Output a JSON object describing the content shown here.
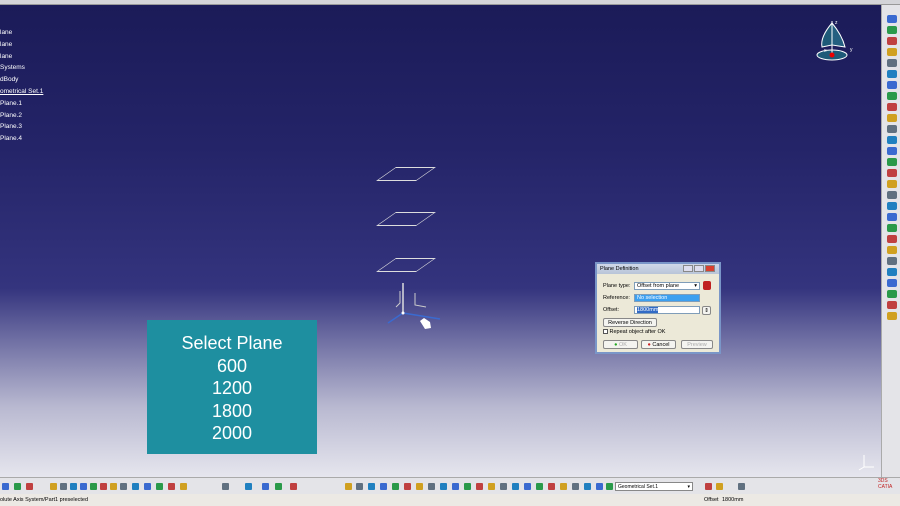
{
  "tree": {
    "items": [
      "lane",
      "lane",
      "lane",
      "Systems",
      "dBody",
      "ometrical Set.1",
      "Plane.1",
      "Plane.2",
      "Plane.3",
      "Plane.4"
    ]
  },
  "overlay": {
    "lines": [
      "Select Plane",
      "600",
      "1200",
      "1800",
      "2000"
    ]
  },
  "dialog": {
    "title": "Plane Definition",
    "plane_type_label": "Plane type:",
    "plane_type_value": "Offset from plane",
    "reference_label": "Reference:",
    "reference_value": "No selection",
    "offset_label": "Offset:",
    "offset_value": "1800mm",
    "reverse_label": "Reverse Direction",
    "repeat_label": "Repeat object after OK",
    "repeat_checked": false,
    "ok_label": "OK",
    "cancel_label": "Cancel",
    "preview_label": "Preview"
  },
  "compass": {
    "x_label": "x",
    "y_label": "y",
    "z_label": "z"
  },
  "toolbar": {
    "geometrical_set": "Geometrical Set.1"
  },
  "status": {
    "message": "olute Axis System/Part1 preselected",
    "offset_label": "Offset",
    "offset_value": "1800mm"
  },
  "logo": "CATIA"
}
